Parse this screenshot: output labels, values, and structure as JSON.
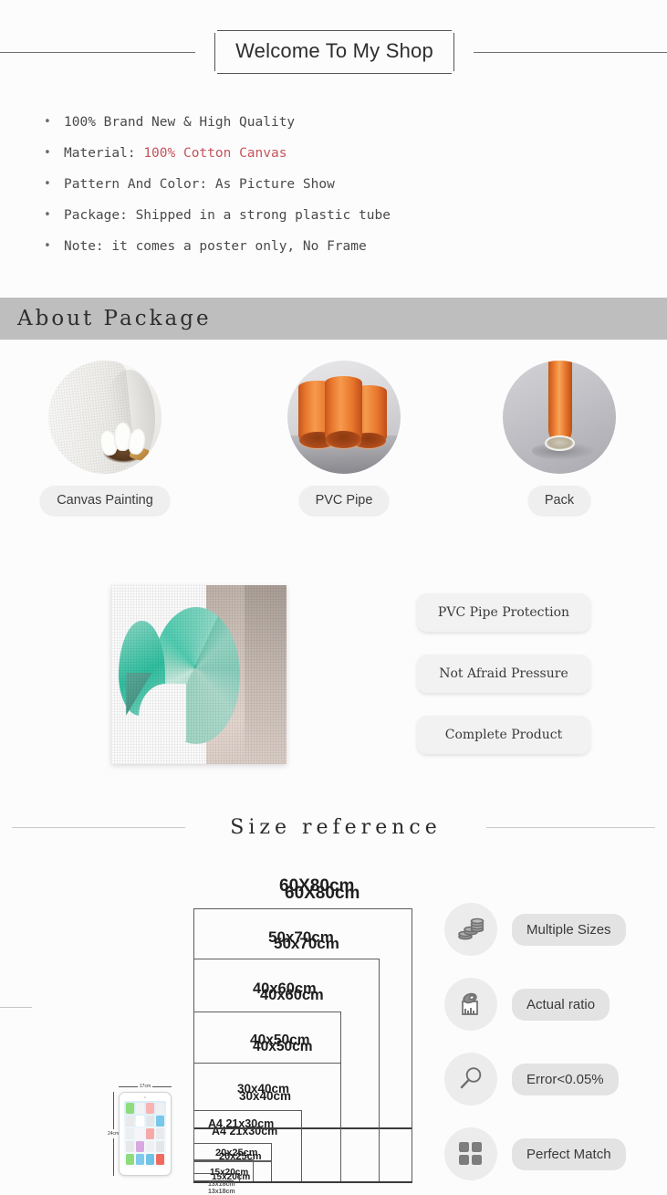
{
  "header": {
    "welcome_title": "Welcome To My Shop"
  },
  "features": [
    {
      "text": "100% Brand New & High Quality",
      "prefix": "100% Brand New & High Quality",
      "highlight": ""
    },
    {
      "prefix": "Material: ",
      "highlight": "100% Cotton Canvas"
    },
    {
      "prefix": "Pattern And Color: As Picture Show",
      "highlight": ""
    },
    {
      "prefix": "Package: Shipped in a strong plastic tube",
      "highlight": ""
    },
    {
      "prefix": "Note: it comes a poster only, No Frame",
      "highlight": ""
    }
  ],
  "about_package": {
    "banner_title": "About Package",
    "cards": [
      {
        "label": "Canvas Painting",
        "icon": "cotton-canvas-roll-icon"
      },
      {
        "label": "PVC Pipe",
        "icon": "orange-pvc-pipes-icon"
      },
      {
        "label": "Pack",
        "icon": "rolled-tube-pack-icon"
      }
    ],
    "tags": [
      "PVC Pipe Protection",
      "Not Afraid Pressure",
      "Complete Product"
    ]
  },
  "size_reference": {
    "title": "Size reference",
    "sizes": [
      {
        "label": "60X80cm"
      },
      {
        "label": "50x70cm"
      },
      {
        "label": "40x60cm"
      },
      {
        "label": "40x50cm"
      },
      {
        "label": "30x40cm"
      },
      {
        "label": "A4  21x30cm"
      },
      {
        "label": "20x25cm"
      },
      {
        "label": "15x20cm"
      },
      {
        "label": "13x18cm"
      }
    ],
    "tablet": {
      "width_label": "17cm",
      "height_label": "24cm"
    },
    "benefits": [
      {
        "label": "Multiple Sizes",
        "icon": "coin-stacks-icon"
      },
      {
        "label": "Actual ratio",
        "icon": "measuring-tape-icon"
      },
      {
        "label": "Error<0.05%",
        "icon": "magnifier-icon"
      },
      {
        "label": "Perfect Match",
        "icon": "grid-four-squares-icon"
      }
    ]
  },
  "colors": {
    "background": "#fdfcfd",
    "banner_gray": "#bebebe",
    "highlight_red": "#c4545a",
    "pill_gray": "#efefef",
    "orange": "#e8762c",
    "teal": "#2ec4a3"
  }
}
